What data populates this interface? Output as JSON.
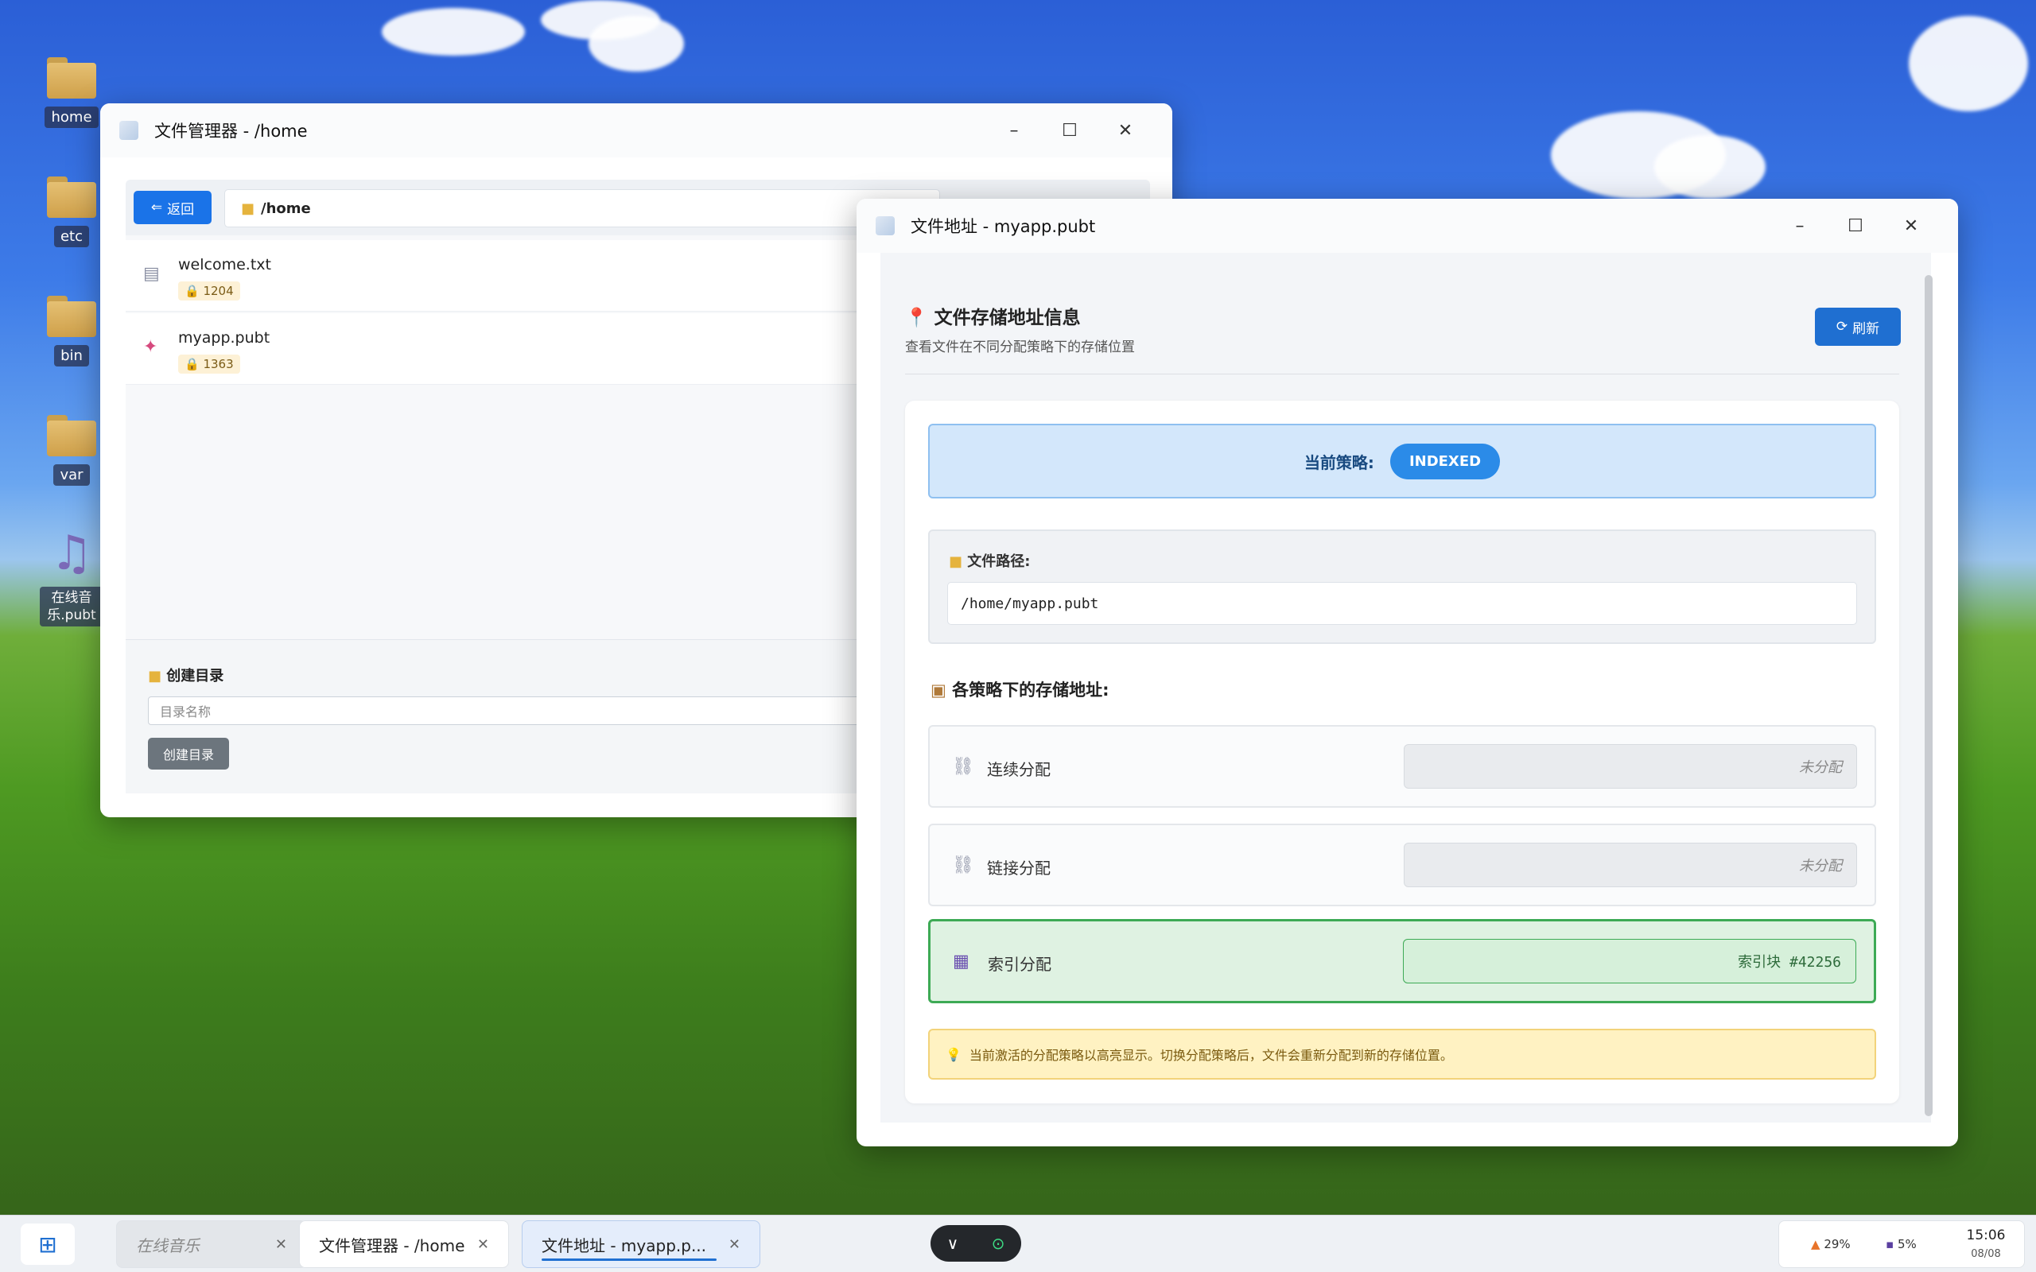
{
  "desktop": {
    "icons": [
      {
        "label": "home",
        "icon": "folder-icon"
      },
      {
        "label": "etc",
        "icon": "folder-icon"
      },
      {
        "label": "bin",
        "icon": "folder-icon"
      },
      {
        "label": "var",
        "icon": "folder-icon"
      },
      {
        "label": "在线音乐.pubt",
        "icon": "music-note-icon"
      }
    ]
  },
  "file_manager": {
    "title": "文件管理器 - /home",
    "back_label": "返回",
    "path": "/home",
    "files": [
      {
        "name": "welcome.txt",
        "badge": "1204",
        "icon": "text-file-icon"
      },
      {
        "name": "myapp.pubt",
        "badge": "1363",
        "icon": "app-file-icon"
      }
    ],
    "mkdir_label": "创建目录",
    "mkdir_placeholder": "目录名称",
    "mkdir_button": "创建目录"
  },
  "address_window": {
    "title": "文件地址 - myapp.pubt",
    "heading": "文件存储地址信息",
    "subheading": "查看文件在不同分配策略下的存储位置",
    "refresh_label": "刷新",
    "current_strategy_label": "当前策略:",
    "current_strategy": "INDEXED",
    "path_label": "文件路径:",
    "path_value": "/home/myapp.pubt",
    "strategies_heading": "各策略下的存储地址:",
    "strategies": [
      {
        "name": "连续分配",
        "value": "未分配",
        "icon": "link-icon",
        "active": false
      },
      {
        "name": "链接分配",
        "value": "未分配",
        "icon": "link-icon",
        "active": false
      },
      {
        "name": "索引分配",
        "value": "索引块 #42256",
        "icon": "index-block-icon",
        "active": true
      }
    ],
    "tip": "当前激活的分配策略以高亮显示。切换分配策略后，文件会重新分配到新的存储位置。"
  },
  "taskbar": {
    "tasks": [
      {
        "label": "在线音乐",
        "state": "dim"
      },
      {
        "label": "文件管理器 - /home",
        "state": "normal"
      },
      {
        "label": "文件地址 - myapp.p...",
        "state": "active"
      }
    ],
    "tray": {
      "cpu": "29%",
      "mem": "5%",
      "time": "15:06",
      "date": "08/08"
    }
  },
  "colors": {
    "accent": "#1f6fd1",
    "active_green": "#3daa55",
    "strategy_blue": "#2b8be8"
  }
}
